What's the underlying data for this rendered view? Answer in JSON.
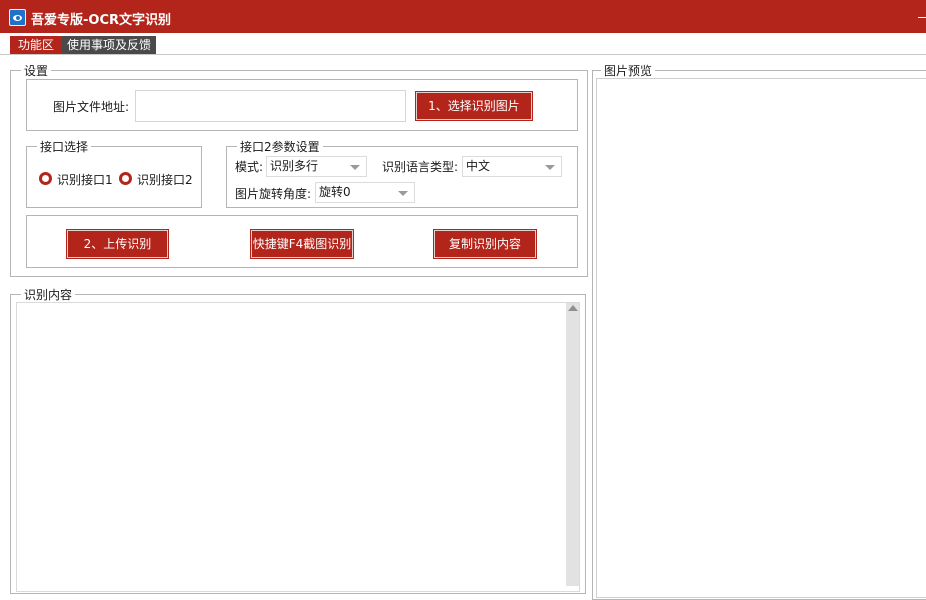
{
  "window": {
    "title": "吾爱专版-OCR文字识别",
    "app_icon": "eye-icon",
    "minimize_icon": "minimize-icon",
    "accent_color": "#b3251b"
  },
  "tabs": [
    {
      "label": "功能区",
      "active": true
    },
    {
      "label": "使用事项及反馈",
      "active": false
    }
  ],
  "settings": {
    "legend": "设置",
    "file": {
      "label": "图片文件地址:",
      "value": "",
      "placeholder": ""
    },
    "select_image_button": "1、选择识别图片",
    "api_select": {
      "legend": "接口选择",
      "options": [
        "识别接口1",
        "识别接口2"
      ]
    },
    "api2_params": {
      "legend": "接口2参数设置",
      "mode_label": "模式:",
      "mode_value": "识别多行",
      "lang_label": "识别语言类型:",
      "lang_value": "中文",
      "rotate_label": "图片旋转角度:",
      "rotate_value": "旋转0"
    },
    "actions": {
      "upload_button": "2、上传识别",
      "screenshot_button": "快捷键F4截图识别",
      "copy_button": "复制识别内容"
    }
  },
  "result": {
    "legend": "识别内容",
    "content": ""
  },
  "preview": {
    "legend": "图片预览"
  }
}
